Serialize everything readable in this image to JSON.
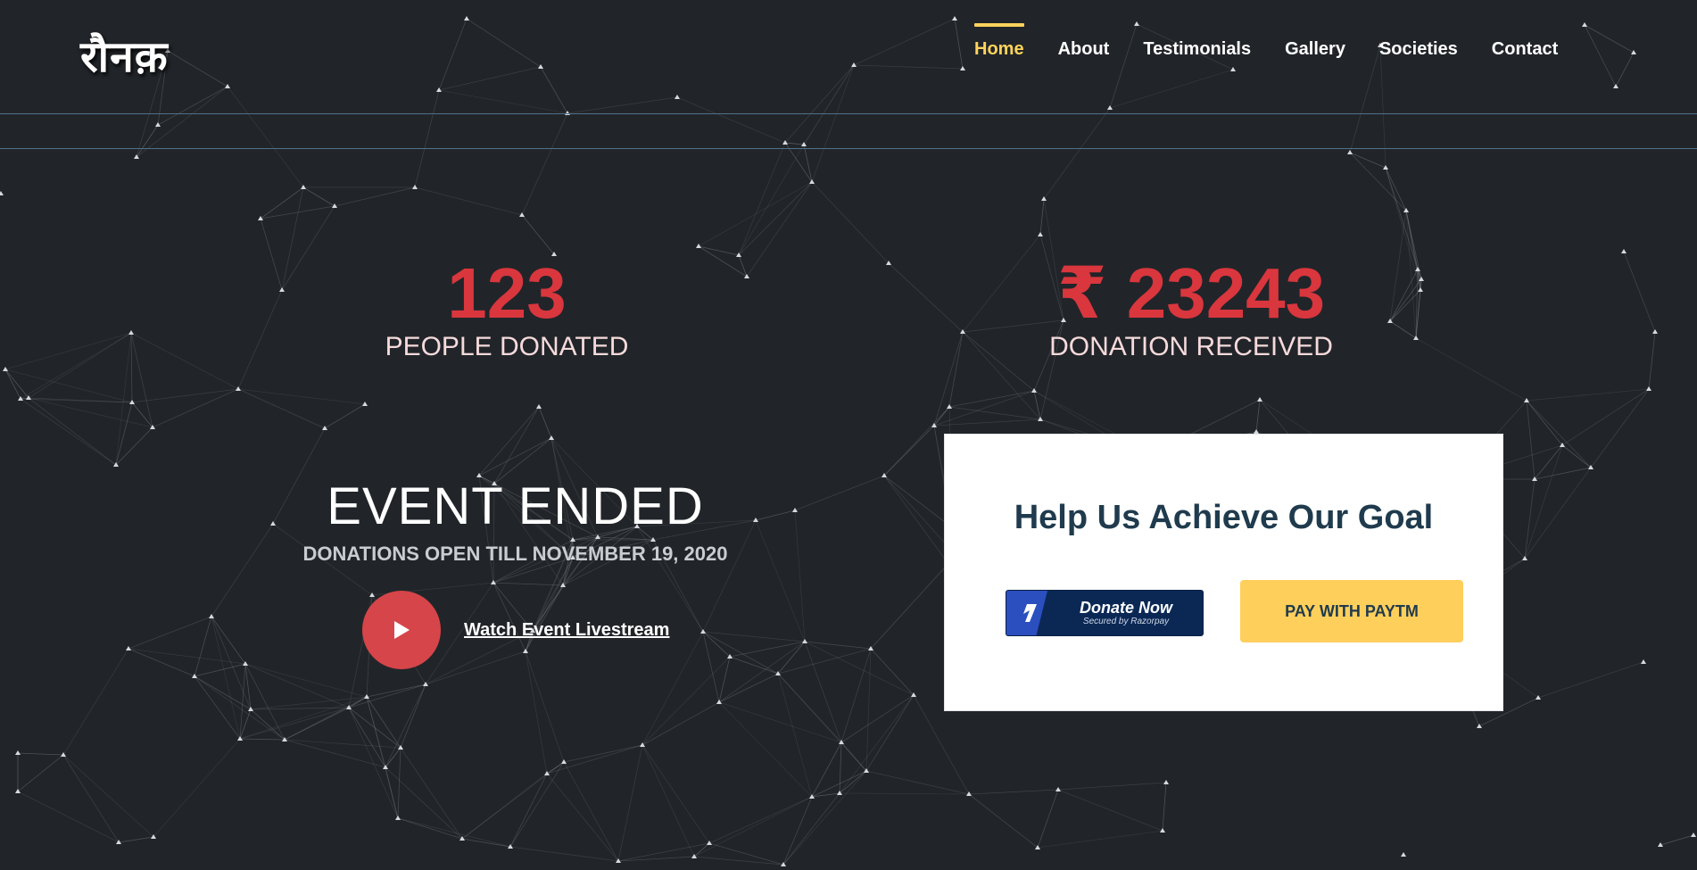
{
  "brand": {
    "logo_text": "रौनक़"
  },
  "nav": {
    "items": [
      {
        "label": "Home",
        "active": true
      },
      {
        "label": "About",
        "active": false
      },
      {
        "label": "Testimonials",
        "active": false
      },
      {
        "label": "Gallery",
        "active": false
      },
      {
        "label": "Societies",
        "active": false
      },
      {
        "label": "Contact",
        "active": false
      }
    ],
    "active_color": "#ffd35c"
  },
  "stats": {
    "people": {
      "value": "123",
      "label": "PEOPLE DONATED"
    },
    "amount": {
      "value": "₹ 23243",
      "label": "DONATION RECEIVED"
    }
  },
  "event": {
    "status": "EVENT ENDED",
    "subtitle": "DONATIONS OPEN TILL NOVEMBER 19, 2020",
    "watch_link": "Watch Event Livestream",
    "play_icon": "play-icon"
  },
  "goal": {
    "heading": "Help Us Achieve Our Goal",
    "razorpay": {
      "label": "Donate Now",
      "secured": "Secured by Razorpay",
      "icon": "razorpay-logo-icon"
    },
    "paytm_label": "PAY WITH PAYTM"
  },
  "colors": {
    "background": "#212529",
    "accent_red": "#d9363e",
    "accent_yellow": "#ffcf5c",
    "heading_navy": "#1f3b4d"
  }
}
